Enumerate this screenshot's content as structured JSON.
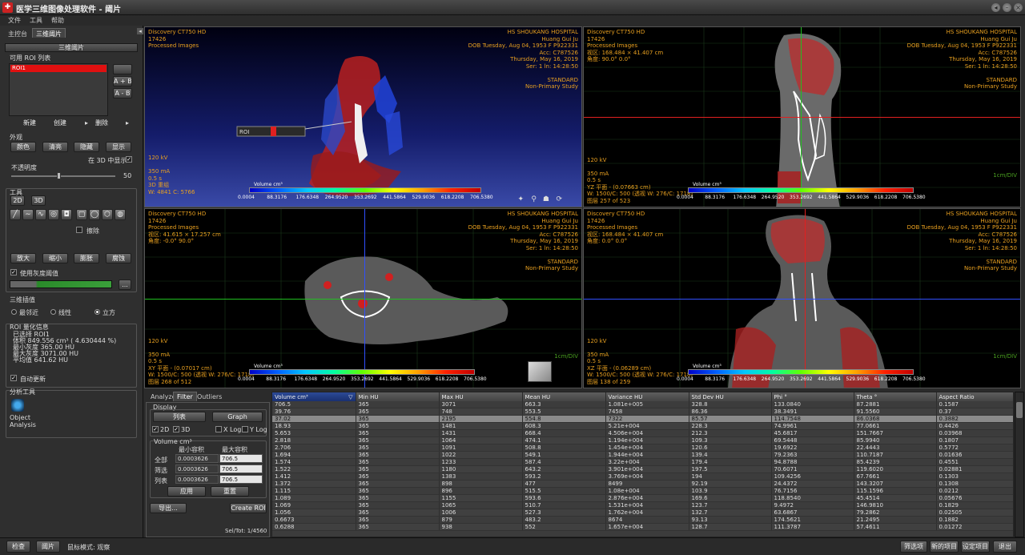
{
  "window": {
    "title": "医学三维图像处理软件 - 阈片",
    "controls": [
      "◂",
      "–",
      "×"
    ]
  },
  "menu": [
    "文件",
    "工具",
    "帮助"
  ],
  "left_panel": {
    "tabs": [
      "主控台",
      "三维阈片"
    ],
    "section_title": "三维阈片",
    "roi_list_label": "可用 ROI 列表",
    "roi_items": [
      "ROI1"
    ],
    "side_buttons": [
      "",
      "A + B",
      "A - B"
    ],
    "list_buttons": [
      "新建",
      "创建",
      "删除"
    ],
    "list_arrows": [
      "▸",
      "▸"
    ],
    "appearance_label": "外观",
    "appearance_buttons": [
      "颜色",
      "清亮",
      "隐藏",
      "显示"
    ],
    "show_in_3d_label": "在 3D 中显示",
    "opacity_label": "不透明度",
    "opacity_value": "50",
    "opacity_fraction": 0.45,
    "tools_label": "工具",
    "tool_mode_buttons": [
      "2D",
      "3D"
    ],
    "draw_icons": [
      "pencil-icon",
      "curve-icon",
      "freehand-icon",
      "circle-icon",
      "magic-wand-icon",
      "square-icon",
      "ellipse-icon",
      "polygon-icon",
      "fill-icon"
    ],
    "draw_glyphs": [
      "╱",
      "∼",
      "∿",
      "◎",
      "◘",
      "▢",
      "◯",
      "⬡",
      "◍"
    ],
    "brush_label": "擦除",
    "action_buttons": [
      "放大",
      "缩小",
      "膨胀",
      "腐蚀"
    ],
    "use_threshold_label": "使用灰度阈值",
    "more_button": "...",
    "interp_label": "三维插值",
    "interp_options": [
      "最邻近",
      "线性",
      "立方"
    ],
    "interp_selected": 2,
    "stats_label": "ROI 量化信息",
    "stats_lines": [
      "已选择 ROI1",
      "体积 849.556 cm³ ( 4.630444 %)",
      "最小灰度 365.00 HU",
      "最大灰度 3071.00 HU",
      "平均值 641.62 HU"
    ],
    "auto_update_label": "自动更新",
    "analysis_label": "分析工具",
    "object_analysis_label": [
      "Object",
      "Analysis"
    ]
  },
  "viewports": {
    "v3d": {
      "tl": [
        "Discovery CT750 HD",
        "17426",
        "Processed Images"
      ],
      "tr": [
        "HS SHOUKANG HOSPITAL",
        "Huang Gui Ju",
        "DOB Tuesday, Aug 04, 1953 F P922331",
        "Acc: C787526",
        "Thursday, May 16, 2019",
        "Ser: 1 ln: 14:28:50",
        "",
        "STANDARD",
        "Non-Primary Study"
      ],
      "bl": [
        "120 kV",
        "",
        "350 mA",
        "0.5 s",
        "3D 重组",
        "W: 4841 C: 5766"
      ],
      "roi_label": "ROI",
      "cbar_title": "Volume cm³",
      "cbar_ticks": [
        "0.0004",
        "88.3176",
        "176.6348",
        "264.9520",
        "353.2692",
        "441.5864",
        "529.9036",
        "618.2208",
        "706.5380"
      ]
    },
    "sag": {
      "tl": [
        "Discovery CT750 HD",
        "17426",
        "Processed Images",
        "视区: 168.484 × 41.407 cm",
        "角度: 90.0° 0.0°"
      ],
      "tr": [
        "HS SHOUKANG HOSPITAL",
        "Huang Gui Ju",
        "DOB Tuesday, Aug 04, 1953 F P922331",
        "Acc: C787526",
        "Thursday, May 16, 2019",
        "Ser: 1 ln: 14:28:50",
        "",
        "STANDARD",
        "Non-Primary Study"
      ],
      "bl": [
        "120 kV",
        "",
        "350 mA",
        "0.5 s",
        "YZ 平面 - (0.07663 cm)",
        "W: 1500/C: 500 (透视 W: 276/C: 1718)",
        "图层 257 of 523"
      ],
      "br": "1cm/DIV",
      "cbar_title": "Volume cm³",
      "cbar_ticks": [
        "0.0004",
        "88.3176",
        "176.6348",
        "264.9520",
        "353.2692",
        "441.5864",
        "529.9036",
        "618.2208",
        "706.5380"
      ]
    },
    "axial": {
      "tl": [
        "Discovery CT750 HD",
        "17426",
        "Processed Images",
        "视区: 41.615 × 17.257 cm",
        "角度: -0.0° 90.0°"
      ],
      "tr": [
        "HS SHOUKANG HOSPITAL",
        "Huang Gui Ju",
        "DOB Tuesday, Aug 04, 1953 F P922331",
        "Acc: C787526",
        "Thursday, May 16, 2019",
        "Ser: 1 ln: 14:28:50",
        "",
        "STANDARD",
        "Non-Primary Study"
      ],
      "bl": [
        "120 kV",
        "",
        "350 mA",
        "0.5 s",
        "XY 平面 - (0.07017 cm)",
        "W: 1500/C: 500 (透视 W: 276/C: 1718)",
        "图层 268 of 512"
      ],
      "br": "1cm/DIV",
      "cbar_title": "Volume cm³",
      "cbar_ticks": [
        "0.0004",
        "88.3176",
        "176.6348",
        "264.9520",
        "353.2692",
        "441.5864",
        "529.9036",
        "618.2208",
        "706.5380"
      ]
    },
    "cor": {
      "tl": [
        "Discovery CT750 HD",
        "17426",
        "Processed Images",
        "视区: 168.484 × 41.407 cm",
        "角度: 0.0° 0.0°"
      ],
      "tr": [
        "HS SHOUKANG HOSPITAL",
        "Huang Gui Ju",
        "DOB Tuesday, Aug 04, 1953 F P922331",
        "Acc: C787526",
        "Thursday, May 16, 2019",
        "Ser: 1 ln: 14:28:50",
        "",
        "STANDARD",
        "Non-Primary Study"
      ],
      "bl": [
        "120 kV",
        "",
        "350 mA",
        "0.5 s",
        "XZ 平面 - (0.06289 cm)",
        "W: 1500/C: 500 (透视 W: 276/C: 1718)",
        "图层 138 of 259"
      ],
      "br": "1cm/DIV",
      "cbar_title": "Volume cm³",
      "cbar_ticks": [
        "0.0004",
        "88.3176",
        "176.6348",
        "264.9520",
        "353.2692",
        "441.5864",
        "529.9036",
        "618.2208",
        "706.5380"
      ]
    }
  },
  "bottom_panel": {
    "tabs": [
      "Analyze",
      "Filter",
      "Outliers"
    ],
    "active_tab": 1,
    "display_label": "Display",
    "list_button": "列表",
    "graph_button": "Graph",
    "checks": [
      "2D",
      "3D",
      "X Log",
      "Y Log"
    ],
    "volume_label": "Volume cm³",
    "min_header": "最小容积",
    "max_header": "最大容积",
    "rows": [
      {
        "label": "全部",
        "min": "0.0003626",
        "max": "706.5"
      },
      {
        "label": "筛选",
        "min": "0.0003626",
        "max": "706.5"
      },
      {
        "label": "列表",
        "min": "0.0003626",
        "max": "706.5"
      }
    ],
    "apply_button": "应用",
    "reset_button": "重置",
    "export_button": "导出...",
    "create_roi_button": "Create ROI",
    "sel_tot": "Sel/Tot: 1/4560"
  },
  "table": {
    "columns": [
      "Volume cm³",
      "Min HU",
      "Max HU",
      "Mean HU",
      "Variance HU",
      "Std Dev HU",
      "Phi °",
      "Theta °",
      "Aspect Ratio"
    ],
    "sorted_indicator": "▽",
    "selected_row": 2,
    "rows": [
      [
        "706.5",
        "365",
        "3071",
        "663.3",
        "1.081e+005",
        "328.8",
        "133.0840",
        "87.2881",
        "0.1587"
      ],
      [
        "39.76",
        "365",
        "748",
        "553.5",
        "7458",
        "86.36",
        "38.3491",
        "91.5560",
        "0.37"
      ],
      [
        "37.02",
        "365",
        "2195",
        "554.8",
        "7322",
        "85.57",
        "114.7548",
        "86.0368",
        "0.3882"
      ],
      [
        "18.93",
        "365",
        "1481",
        "608.3",
        "5.21e+004",
        "228.3",
        "74.9961",
        "77.0661",
        "0.4426"
      ],
      [
        "5.653",
        "365",
        "1431",
        "668.4",
        "4.506e+004",
        "212.3",
        "45.6817",
        "151.7667",
        "0.03968"
      ],
      [
        "2.818",
        "365",
        "1064",
        "474.1",
        "1.194e+004",
        "109.3",
        "69.5448",
        "85.9940",
        "0.1807"
      ],
      [
        "2.706",
        "365",
        "1091",
        "508.8",
        "1.454e+004",
        "120.6",
        "19.6922",
        "22.4443",
        "0.5772"
      ],
      [
        "1.694",
        "365",
        "1022",
        "549.1",
        "1.944e+004",
        "139.4",
        "79.2363",
        "110.7187",
        "0.01636"
      ],
      [
        "1.574",
        "365",
        "1233",
        "587.4",
        "3.22e+004",
        "179.4",
        "94.8788",
        "85.4239",
        "0.4551"
      ],
      [
        "1.522",
        "365",
        "1180",
        "643.2",
        "3.901e+004",
        "197.5",
        "70.6071",
        "119.6020",
        "0.02881"
      ],
      [
        "1.412",
        "365",
        "1383",
        "593.2",
        "3.769e+004",
        "194",
        "109.4256",
        "67.7661",
        "0.1303"
      ],
      [
        "1.372",
        "365",
        "898",
        "477",
        "8499",
        "92.19",
        "24.4372",
        "143.3207",
        "0.1308"
      ],
      [
        "1.115",
        "365",
        "896",
        "515.5",
        "1.08e+004",
        "103.9",
        "76.7156",
        "115.1596",
        "0.0212"
      ],
      [
        "1.089",
        "365",
        "1155",
        "593.6",
        "2.876e+004",
        "169.6",
        "118.8540",
        "45.4514",
        "0.05676"
      ],
      [
        "1.069",
        "365",
        "1065",
        "510.7",
        "1.531e+004",
        "123.7",
        "9.4972",
        "146.9810",
        "0.1829"
      ],
      [
        "1.056",
        "365",
        "1006",
        "527.3",
        "1.762e+004",
        "132.7",
        "63.6867",
        "79.2862",
        "0.02505"
      ],
      [
        "0.6673",
        "365",
        "879",
        "483.2",
        "8674",
        "93.13",
        "174.5621",
        "21.2495",
        "0.1882"
      ],
      [
        "0.6288",
        "365",
        "938",
        "552",
        "1.657e+004",
        "128.7",
        "111.3787",
        "57.4611",
        "0.01272"
      ]
    ]
  },
  "statusbar": {
    "left_buttons": [
      "检查",
      "阈片"
    ],
    "mode_label": "鼠标模式: 观察",
    "right_buttons": [
      "筛选项",
      "新的项目",
      "设定项目",
      "退出"
    ]
  },
  "colors": {
    "roi_red": "#e01010",
    "overlay_orange": "#e8a020",
    "crosshair_green": "#20c020",
    "crosshair_red": "#e02020",
    "crosshair_blue": "#3050ff"
  }
}
